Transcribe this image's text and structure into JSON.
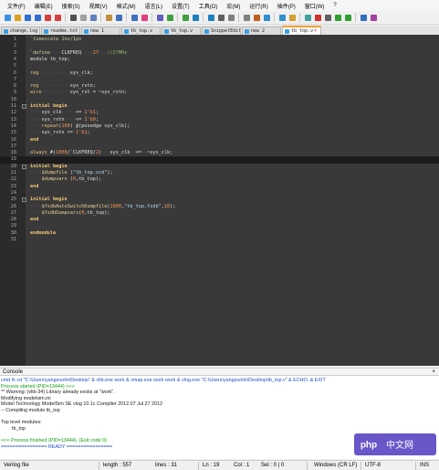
{
  "menubar": {
    "items": [
      "文件(F)",
      "编辑(E)",
      "搜索(S)",
      "视图(V)",
      "格式(M)",
      "语言(L)",
      "设置(T)",
      "工具(O)",
      "宏(M)",
      "运行(R)",
      "插件(P)",
      "窗口(W)",
      "?"
    ]
  },
  "toolbar": {
    "buttons": [
      "new-icon",
      "open-icon",
      "save-icon",
      "save-all-icon",
      "close-icon",
      "close-all-icon",
      "print-icon",
      "cut-icon",
      "copy-icon",
      "paste-icon",
      "undo-icon",
      "redo-icon",
      "find-icon",
      "replace-icon",
      "zoom-in-icon",
      "zoom-out-icon",
      "sync-v-icon",
      "sync-h-icon",
      "wrap-icon",
      "all-chars-icon",
      "indent-guide-icon",
      "lang-icon",
      "doc-map-icon",
      "func-list-icon",
      "folder-icon",
      "monitor-icon",
      "record-icon",
      "stop-icon",
      "play-icon",
      "play-multi-icon",
      "save-macro-icon",
      "abc-icon"
    ],
    "colors": [
      "#3a8ee6",
      "#e0a020",
      "#2f6fd0",
      "#2f6fd0",
      "#d84040",
      "#d84040",
      "#505050",
      "#a0a0a0",
      "#6080c0",
      "#c09040",
      "#4070c0",
      "#4070c0",
      "#e04080",
      "#6060c0",
      "#40a040",
      "#40a040",
      "#2080c0",
      "#2080c0",
      "#606060",
      "#808080",
      "#808080",
      "#c06020",
      "#3090d0",
      "#3090d0",
      "#d0a030",
      "#40a0a0",
      "#d03030",
      "#606060",
      "#30a030",
      "#30a030",
      "#3070c0",
      "#a040a0"
    ]
  },
  "tabs": [
    {
      "label": "change.log",
      "active": false
    },
    {
      "label": "readme.txt",
      "active": false
    },
    {
      "label": "new 1",
      "active": false
    },
    {
      "label": "tb_top.v",
      "active": false
    },
    {
      "label": "tb_top.v",
      "active": false
    },
    {
      "label": "SnippetEditor.fsh",
      "active": false
    },
    {
      "label": "new 2",
      "active": false
    },
    {
      "label": "tb_top.v",
      "active": true
    }
  ],
  "editor": {
    "current_line": 19,
    "lines": [
      {
        "n": "1",
        "fold": false,
        "t": [
          [
            "dir",
            "`timescale 1ns/1ps"
          ]
        ]
      },
      {
        "n": "2",
        "fold": false,
        "t": []
      },
      {
        "n": "3",
        "fold": false,
        "t": [
          [
            "dir",
            "`define"
          ],
          [
            "ws",
            "····"
          ],
          [
            "def",
            "CLKFREQ"
          ],
          [
            "ws",
            "····"
          ],
          [
            "num",
            "27"
          ],
          [
            "ws",
            "···"
          ],
          [
            "cmt",
            "//27MHz"
          ]
        ]
      },
      {
        "n": "4",
        "fold": false,
        "t": [
          [
            "def",
            "module tb_top;"
          ]
        ]
      },
      {
        "n": "5",
        "fold": false,
        "t": []
      },
      {
        "n": "6",
        "fold": false,
        "t": [
          [
            "kw2",
            "reg"
          ],
          [
            "ws",
            "···········"
          ],
          [
            "def",
            "sys_clk;"
          ]
        ]
      },
      {
        "n": "7",
        "fold": false,
        "t": []
      },
      {
        "n": "8",
        "fold": false,
        "t": [
          [
            "kw2",
            "reg"
          ],
          [
            "ws",
            "···········"
          ],
          [
            "def",
            "sys_rstn;"
          ]
        ]
      },
      {
        "n": "9",
        "fold": false,
        "t": [
          [
            "kw2",
            "wire"
          ],
          [
            "ws",
            "··········"
          ],
          [
            "def",
            "sys_rst = ~sys_rstn;"
          ]
        ]
      },
      {
        "n": "10",
        "fold": false,
        "t": []
      },
      {
        "n": "11",
        "fold": true,
        "t": [
          [
            "kw",
            "initial begin"
          ]
        ]
      },
      {
        "n": "12",
        "fold": false,
        "t": [
          [
            "ws",
            "····"
          ],
          [
            "def",
            "sys_clk"
          ],
          [
            "ws",
            "·····"
          ],
          [
            "def",
            "<= "
          ],
          [
            "num",
            "1'b1"
          ],
          [
            "def",
            ";"
          ]
        ]
      },
      {
        "n": "13",
        "fold": false,
        "t": [
          [
            "ws",
            "····"
          ],
          [
            "def",
            "sys_rstn"
          ],
          [
            "ws",
            "····"
          ],
          [
            "def",
            "<= "
          ],
          [
            "num",
            "1'b0"
          ],
          [
            "def",
            ";"
          ]
        ]
      },
      {
        "n": "14",
        "fold": false,
        "t": [
          [
            "ws",
            "····"
          ],
          [
            "kw2",
            "repeat"
          ],
          [
            "def",
            "("
          ],
          [
            "num",
            "100"
          ],
          [
            "def",
            ") @(posedge sys_clk);"
          ]
        ]
      },
      {
        "n": "15",
        "fold": false,
        "t": [
          [
            "ws",
            "····"
          ],
          [
            "def",
            "sys_rstn <= "
          ],
          [
            "num",
            "1'b1"
          ],
          [
            "def",
            ";"
          ]
        ]
      },
      {
        "n": "16",
        "fold": false,
        "t": [
          [
            "kw",
            "end"
          ]
        ]
      },
      {
        "n": "17",
        "fold": false,
        "t": []
      },
      {
        "n": "18",
        "fold": false,
        "t": [
          [
            "kw2",
            "always"
          ],
          [
            "def",
            " #("
          ],
          [
            "num",
            "1000"
          ],
          [
            "def",
            "/`CLKFREQ/"
          ],
          [
            "num",
            "2"
          ],
          [
            "def",
            ")"
          ],
          [
            "ws",
            "···"
          ],
          [
            "def",
            "sys_clk"
          ],
          [
            "ws",
            "··"
          ],
          [
            "def",
            "<="
          ],
          [
            "ws",
            "··"
          ],
          [
            "def",
            "~sys_clk;"
          ]
        ]
      },
      {
        "n": "19",
        "fold": false,
        "t": []
      },
      {
        "n": "20",
        "fold": true,
        "t": [
          [
            "kw",
            "initial begin"
          ]
        ]
      },
      {
        "n": "21",
        "fold": false,
        "t": [
          [
            "ws",
            "····"
          ],
          [
            "sys",
            "$dumpfile"
          ],
          [
            "def",
            " ("
          ],
          [
            "str",
            "\"tb_top.vcd\""
          ],
          [
            "def",
            ");"
          ]
        ]
      },
      {
        "n": "22",
        "fold": false,
        "t": [
          [
            "ws",
            "····"
          ],
          [
            "sys",
            "$dumpvars"
          ],
          [
            "def",
            " ("
          ],
          [
            "num",
            "0"
          ],
          [
            "def",
            ",tb_top);"
          ]
        ]
      },
      {
        "n": "23",
        "fold": false,
        "t": [
          [
            "kw",
            "end"
          ]
        ]
      },
      {
        "n": "24",
        "fold": false,
        "t": []
      },
      {
        "n": "25",
        "fold": true,
        "t": [
          [
            "kw",
            "initial begin"
          ]
        ]
      },
      {
        "n": "26",
        "fold": false,
        "t": [
          [
            "ws",
            "····"
          ],
          [
            "sys",
            "$fsdbAutoSwitchDumpfile"
          ],
          [
            "def",
            "("
          ],
          [
            "num",
            "1000"
          ],
          [
            "def",
            ","
          ],
          [
            "str",
            "\"tb_top.fsdb\""
          ],
          [
            "def",
            ","
          ],
          [
            "num",
            "10"
          ],
          [
            "def",
            ");"
          ]
        ]
      },
      {
        "n": "27",
        "fold": false,
        "t": [
          [
            "ws",
            "····"
          ],
          [
            "sys",
            "$fsdbDumpvars"
          ],
          [
            "def",
            "("
          ],
          [
            "num",
            "0"
          ],
          [
            "def",
            ",tb_top);"
          ]
        ]
      },
      {
        "n": "28",
        "fold": false,
        "t": [
          [
            "kw",
            "end"
          ]
        ]
      },
      {
        "n": "29",
        "fold": false,
        "t": []
      },
      {
        "n": "30",
        "fold": false,
        "t": [
          [
            "kw",
            "endmodule"
          ]
        ]
      },
      {
        "n": "31",
        "fold": false,
        "t": []
      }
    ]
  },
  "console": {
    "title": "Console",
    "close": "×",
    "lines": [
      {
        "c": "blue",
        "t": "cmd /k cd \"C:\\Users\\yangzuolin\\Desktop\" & vlib.exe work & vmap.exe work work & vlog.exe \"C:\\Users\\yangzuolin\\Desktop\\tb_top.v\" & ECHO. & EXIT"
      },
      {
        "c": "green",
        "t": "Process started (PID=13444) >>>"
      },
      {
        "c": "dark",
        "t": "** Warning: (vlib-34) Library already exists at \"work\"."
      },
      {
        "c": "dark",
        "t": "Modifying modelsim.ini"
      },
      {
        "c": "dark",
        "t": "Model Technology ModelSim SE vlog 10.1c Compiler 2012.07 Jul 27 2012"
      },
      {
        "c": "dark",
        "t": "-- Compiling module tb_top"
      },
      {
        "c": "dark",
        "t": ""
      },
      {
        "c": "dark",
        "t": "Top level modules:"
      },
      {
        "c": "dark",
        "t": "        tb_top"
      },
      {
        "c": "dark",
        "t": ""
      },
      {
        "c": "green",
        "t": "<<< Process finished (PID=13444). (Exit code 0)"
      },
      {
        "c": "blue",
        "t": "================ READY ================"
      }
    ]
  },
  "statusbar": {
    "filetype": "Verilog file",
    "length": "length : 557",
    "lines": "lines : 31",
    "position": "Ln : 19",
    "col": "Col : 1",
    "sel": "Sel : 0 | 0",
    "eol": "Windows (CR LF)",
    "encoding": "UTF-8",
    "mode": "INS"
  },
  "watermark": {
    "text": "php",
    "site": "中文网",
    "bg": "#6a56c8"
  }
}
